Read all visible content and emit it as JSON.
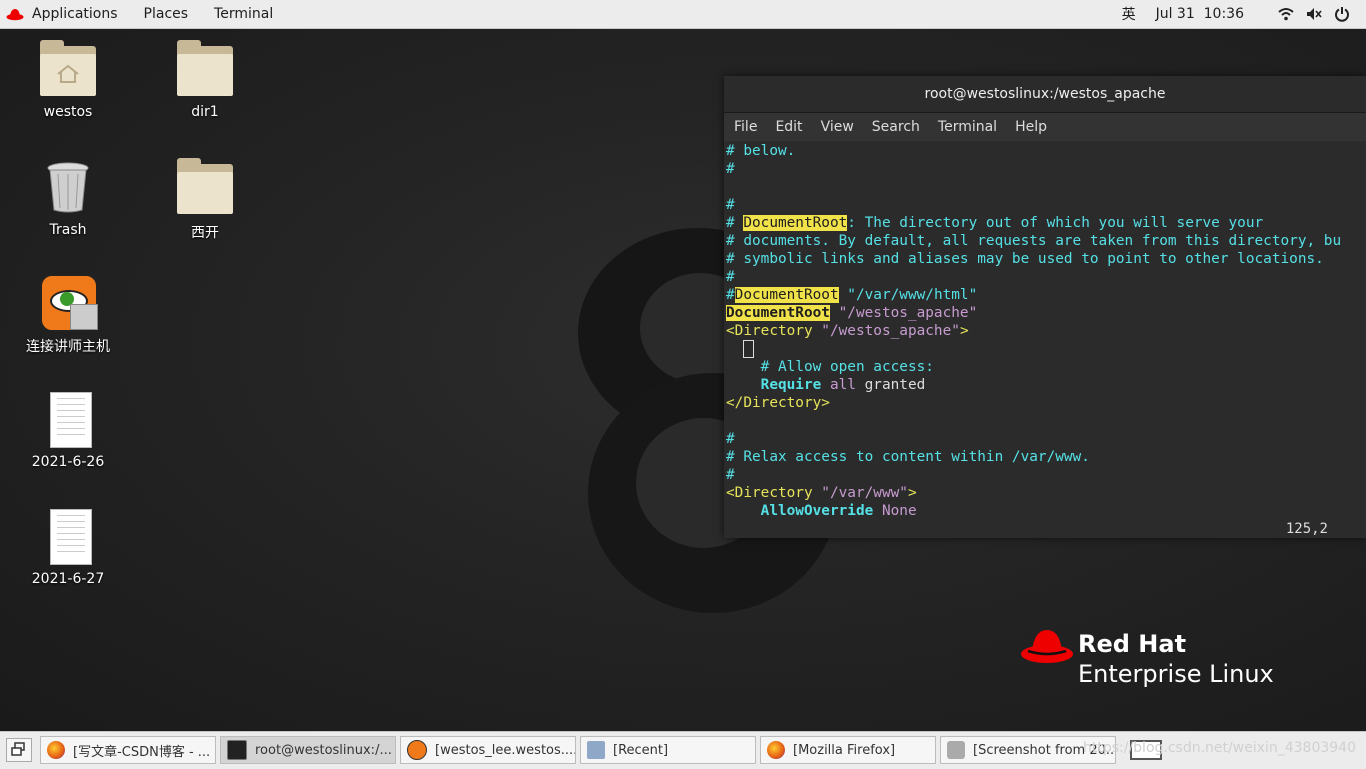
{
  "topbar": {
    "menus": [
      "Applications",
      "Places",
      "Terminal"
    ],
    "input_method": "英",
    "clock": "Jul 31  10:36"
  },
  "desktop_icons": [
    {
      "label": "westos",
      "icon": "home-folder-icon"
    },
    {
      "label": "dir1",
      "icon": "folder-icon"
    },
    {
      "label": "Trash",
      "icon": "trash-icon"
    },
    {
      "label": "西开",
      "icon": "folder-icon"
    },
    {
      "label": "连接讲师主机",
      "icon": "remote-desktop-icon"
    },
    {
      "label": "2021-6-26",
      "icon": "document-icon"
    },
    {
      "label": "2021-6-27",
      "icon": "document-icon"
    }
  ],
  "terminal": {
    "title": "root@westoslinux:/westos_apache",
    "menus": [
      "File",
      "Edit",
      "View",
      "Search",
      "Terminal",
      "Help"
    ],
    "lines": {
      "l1": "# below.",
      "l2": "#",
      "l3": "",
      "l4": "#",
      "l5_a": "# ",
      "l5_b": "DocumentRoot",
      "l5_c": ": The directory out of which you will serve your",
      "l6": "# documents. By default, all requests are taken from this directory, bu",
      "l7": "# symbolic links and aliases may be used to point to other locations.",
      "l8": "#",
      "l9_a": "#",
      "l9_b": "DocumentRoot",
      "l9_c": " \"/var/www/html\"",
      "l10_a": "DocumentRoot",
      "l10_b": " \"/westos_apache\"",
      "l11_a": "<Directory",
      "l11_b": " \"/westos_apache\"",
      "l11_c": ">",
      "l13": "    # Allow open access:",
      "l14_a": "    Require",
      "l14_b": " all",
      "l14_c": " granted",
      "l15": "</Directory>",
      "l16": "",
      "l17": "#",
      "l18": "# Relax access to content within /var/www.",
      "l19": "#",
      "l20_a": "<Directory",
      "l20_b": " \"/var/www\"",
      "l20_c": ">",
      "l21_a": "    AllowOverride",
      "l21_b": " None"
    },
    "cursor_position": "125,2"
  },
  "logo": {
    "line1": "Red Hat",
    "line2": "Enterprise Linux"
  },
  "taskbar": {
    "tasks": [
      {
        "label": "[写文章-CSDN博客 - ...",
        "icon": "firefox-icon"
      },
      {
        "label": "root@westoslinux:/...",
        "icon": "terminal-icon"
      },
      {
        "label": "[westos_lee.westos....",
        "icon": "remote-viewer-icon"
      },
      {
        "label": "[Recent]",
        "icon": "files-icon"
      },
      {
        "label": "[Mozilla Firefox]",
        "icon": "firefox-icon"
      },
      {
        "label": "[Screenshot from 20...",
        "icon": "screenshot-icon"
      }
    ],
    "watermark": "https://blog.csdn.net/weixin_43803940"
  }
}
